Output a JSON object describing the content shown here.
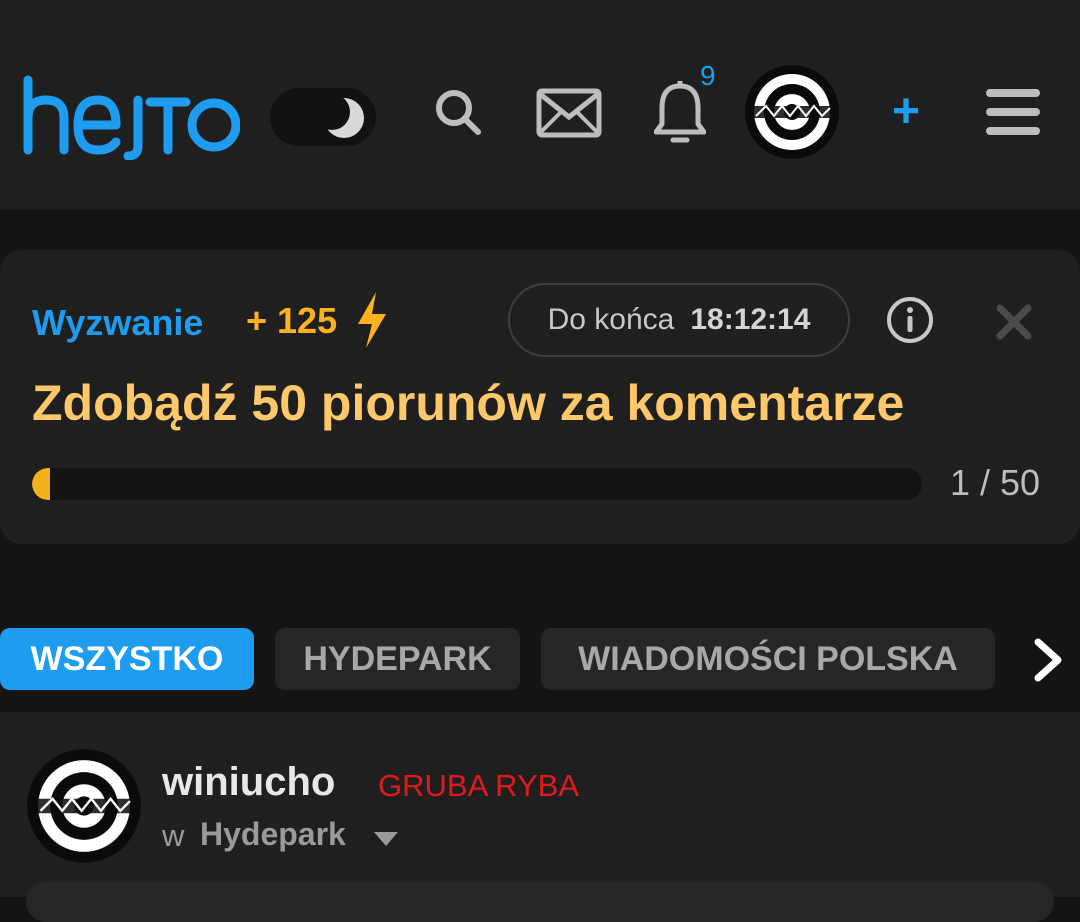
{
  "header": {
    "logo_text": "hejto",
    "notification_count": "9",
    "add_label": "+"
  },
  "challenge": {
    "label": "Wyzwanie",
    "points": "+ 125",
    "timer_label": "Do końca",
    "timer_value": "18:12:14",
    "title": "Zdobądź 50 piorunów za komentarze",
    "progress_current": 1,
    "progress_total": 50,
    "progress_text": "1 / 50"
  },
  "tabs": [
    {
      "label": "WSZYSTKO",
      "active": true
    },
    {
      "label": "HYDEPARK",
      "active": false
    },
    {
      "label": "WIADOMOŚCI POLSKA",
      "active": false
    }
  ],
  "post": {
    "username": "winiucho",
    "rank": "GRUBA RYBA",
    "in_label": "w",
    "community": "Hydepark"
  },
  "colors": {
    "accent": "#1e9cf0",
    "points": "#ffb21e",
    "title": "#ffc86b",
    "rank": "#e01a1a",
    "background": "#141414",
    "surface": "#1f1f1f"
  },
  "icons": [
    "moon-icon",
    "search-icon",
    "mail-icon",
    "bell-icon",
    "avatar",
    "menu-icon",
    "bolt-icon",
    "info-icon",
    "close-icon",
    "chevron-right-icon",
    "caret-down-icon"
  ]
}
